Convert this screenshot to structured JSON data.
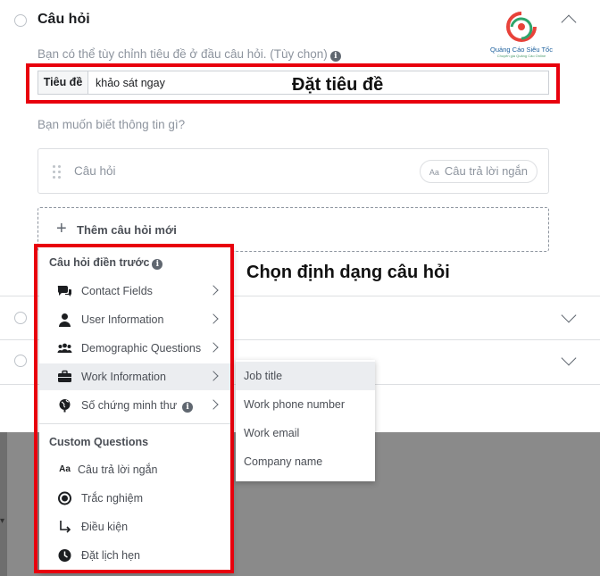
{
  "header": {
    "title": "Câu hỏi"
  },
  "logo": {
    "name": "Quảng Cáo Siêu Tốc",
    "tagline": "Chuyên gia Quảng Cáo Online"
  },
  "title_section": {
    "hint": "Bạn có thể tùy chỉnh tiêu đề ở đầu câu hỏi. (Tùy chọn)",
    "label": "Tiêu đề",
    "value": "khảo sát ngay"
  },
  "annotations": {
    "set_title": "Đặt tiêu đề",
    "choose_format": "Chọn định dạng câu hỏi"
  },
  "question_section": {
    "prompt": "Bạn muốn biết thông tin gì?",
    "card_placeholder": "Câu hỏi",
    "answer_type_icon": "Aa",
    "answer_type": "Câu trả lời ngắn",
    "add_button": "Thêm câu hỏi mới"
  },
  "menu": {
    "prefilled_header": "Câu hỏi điền trước",
    "prefilled_items": [
      {
        "label": "Contact Fields",
        "icon": "chat-bubbles-icon"
      },
      {
        "label": "User Information",
        "icon": "person-icon"
      },
      {
        "label": "Demographic Questions",
        "icon": "group-icon"
      },
      {
        "label": "Work Information",
        "icon": "briefcase-icon"
      },
      {
        "label": "Số chứng minh thư",
        "icon": "globe-icon"
      }
    ],
    "custom_header": "Custom Questions",
    "custom_items": [
      {
        "label": "Câu trả lời ngắn",
        "icon_text": "Aa"
      },
      {
        "label": "Trắc nghiệm",
        "icon": "radio-icon"
      },
      {
        "label": "Điều kiện",
        "icon": "branch-arrow-icon"
      },
      {
        "label": "Đặt lịch hẹn",
        "icon": "clock-icon"
      }
    ]
  },
  "submenu": {
    "items": [
      "Job title",
      "Work phone number",
      "Work email",
      "Company name"
    ]
  },
  "colors": {
    "highlight_red": "#e8000d",
    "menu_hover": "#ebedf0",
    "muted_text": "#8d949e"
  }
}
